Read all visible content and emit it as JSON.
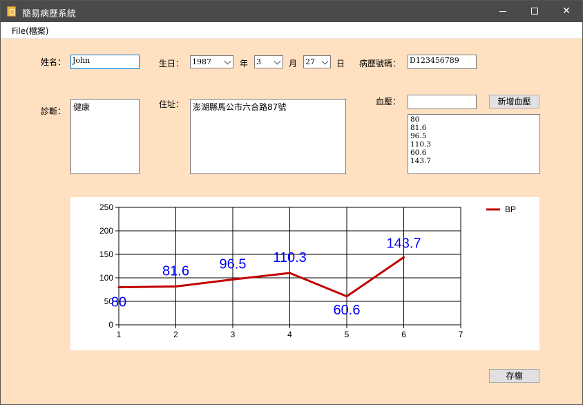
{
  "window": {
    "title": "簡易病歷系統",
    "controls": {
      "minimize": "minimize",
      "maximize": "maximize",
      "close": "✕"
    }
  },
  "menu": {
    "file": "File(檔案)"
  },
  "form": {
    "name_label": "姓名：",
    "name_value": "John",
    "birth_label": "生日：",
    "birth_year": "1987",
    "year_label": "年",
    "birth_month": "3",
    "month_label": "月",
    "birth_day": "27",
    "day_label": "日",
    "record_label": "病歷號碼：",
    "record_value": "D123456789",
    "diagnosis_label": "診斷：",
    "diagnosis_value": "健康",
    "address_label": "住址：",
    "address_value": "澎湖縣馬公市六合路87號",
    "bp_label": "血壓：",
    "bp_input": "",
    "add_bp_button": "新增血壓",
    "bp_list": [
      "80",
      "81.6",
      "96.5",
      "110.3",
      "60.6",
      "143.7"
    ],
    "save_button": "存檔"
  },
  "colors": {
    "series": "#c00000",
    "labels": "#0000ff",
    "client_bg": "#ffe0c0"
  },
  "chart_data": {
    "type": "line",
    "x": [
      1,
      2,
      3,
      4,
      5,
      6
    ],
    "series": [
      {
        "name": "BP",
        "values": [
          80,
          81.6,
          96.5,
          110.3,
          60.6,
          143.7
        ]
      }
    ],
    "xlim": [
      1,
      7
    ],
    "ylim": [
      0,
      250
    ],
    "xticks": [
      1,
      2,
      3,
      4,
      5,
      6,
      7
    ],
    "yticks": [
      0,
      50,
      100,
      150,
      200,
      250
    ],
    "data_labels": [
      "80",
      "81.6",
      "96.5",
      "110.3",
      "60.6",
      "143.7"
    ],
    "grid": true,
    "legend": "top-right",
    "title": "",
    "xlabel": "",
    "ylabel": ""
  }
}
